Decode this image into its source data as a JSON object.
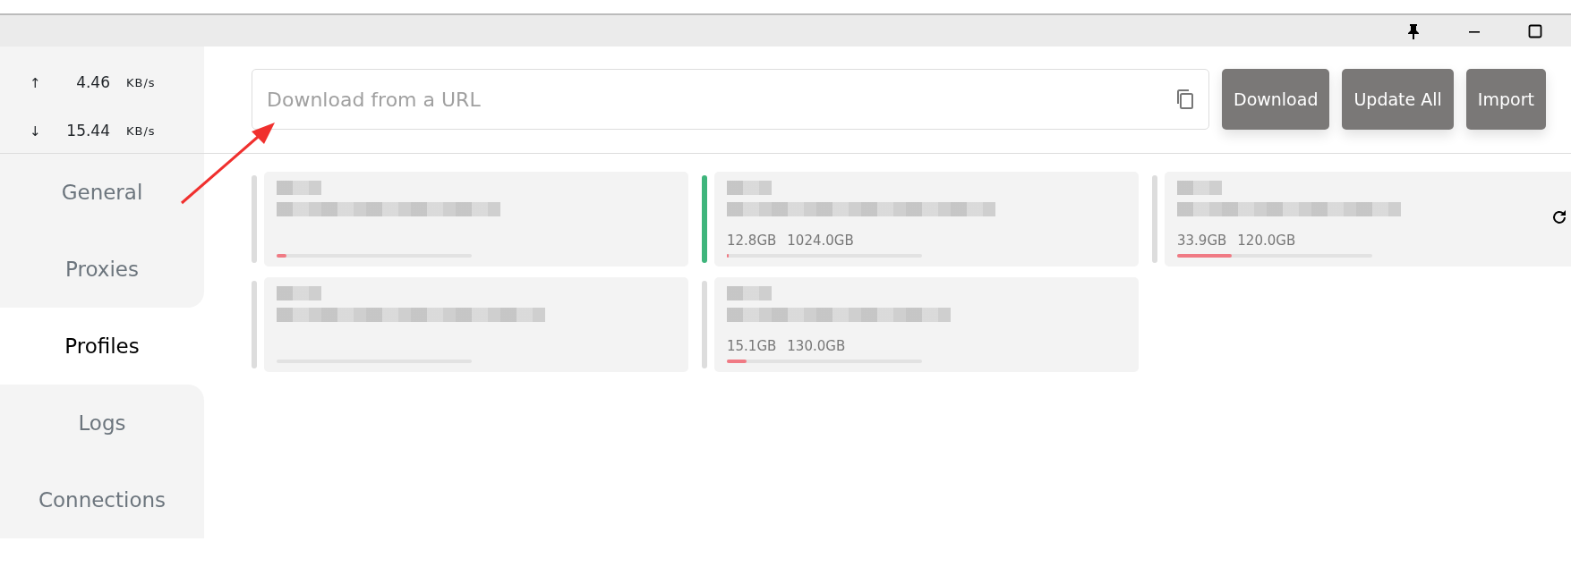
{
  "speeds": [
    {
      "arrow": "↑",
      "value": "4.46",
      "unit": "KB/s"
    },
    {
      "arrow": "↓",
      "value": "15.44",
      "unit": "KB/s"
    }
  ],
  "sidebar": {
    "items": [
      {
        "label": "General",
        "selected": false
      },
      {
        "label": "Proxies",
        "selected": false
      },
      {
        "label": "Profiles",
        "selected": true
      },
      {
        "label": "Logs",
        "selected": false
      },
      {
        "label": "Connections",
        "selected": false
      }
    ]
  },
  "url_field": {
    "placeholder": "Download from a URL"
  },
  "buttons": [
    "Download",
    "Update All",
    "Import"
  ],
  "profiles": [
    {
      "selected": false,
      "updatable": false,
      "level": 0.05
    },
    {
      "selected": true,
      "updatable": false,
      "used": "12.8GB",
      "total": "1024.0GB",
      "level": 0.01
    },
    {
      "selected": false,
      "updatable": true,
      "used": "33.9GB",
      "total": "120.0GB",
      "level": 0.28
    },
    {
      "selected": false,
      "updatable": false,
      "level": 0
    },
    {
      "selected": false,
      "updatable": false,
      "used": "15.1GB",
      "total": "130.0GB",
      "level": 0.1
    }
  ]
}
